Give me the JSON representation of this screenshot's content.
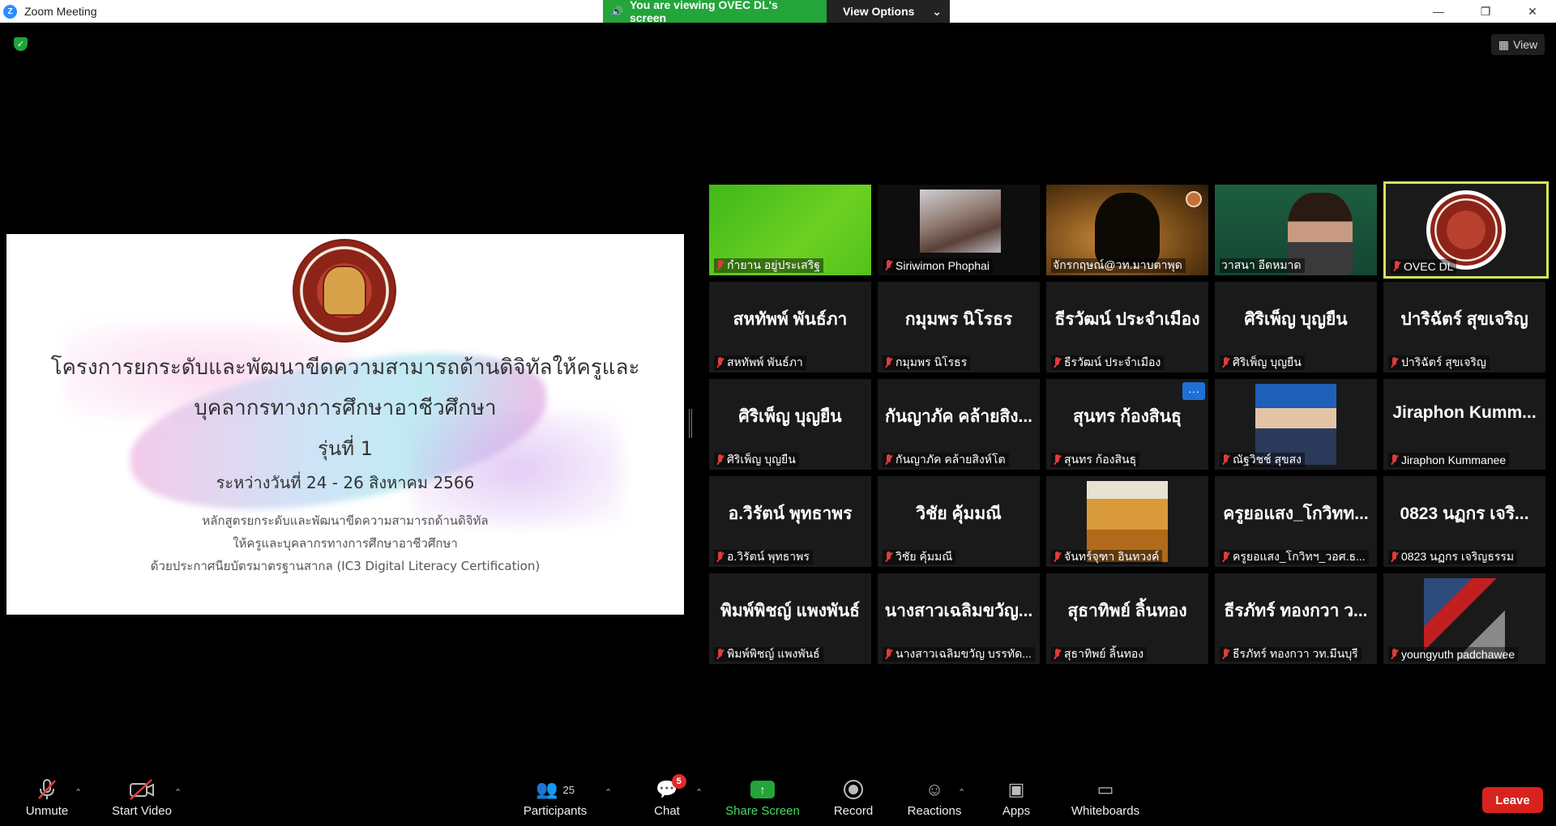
{
  "titlebar": {
    "title": "Zoom Meeting",
    "logo_glyph": "Z"
  },
  "banner": {
    "viewing_text": "You are viewing OVEC DL's screen",
    "view_options": "View Options"
  },
  "view_button": {
    "label": "View"
  },
  "slide": {
    "title_line1": "โครงการยกระดับและพัฒนาขีดความสามารถด้านดิจิทัลให้ครูและ",
    "title_line2": "บุคลากรทางการศึกษาอาชีวศึกษา",
    "generation": "รุ่นที่ 1",
    "date": "ระหว่างวันที่ 24 - 26 สิงหาคม 2566",
    "note_line1": "หลักสูตรยกระดับและพัฒนาขีดความสามารถด้านดิจิทัล",
    "note_line2": "ให้ครูและบุคลากรทางการศึกษาอาชีวศึกษา",
    "note_line3": "ด้วยประกาศนียบัตรมาตรฐานสากล (IC3 Digital Literacy Certification)"
  },
  "gallery": {
    "tiles": [
      {
        "label": "กำยาน อยู่ประเสริฐ",
        "big": ""
      },
      {
        "label": "Siriwimon Phophai",
        "big": ""
      },
      {
        "label": "จักรกฤษณ์@วท.มาบตาพุด",
        "big": ""
      },
      {
        "label": "วาสนา อีดหมาด",
        "big": ""
      },
      {
        "label": "OVEC DL",
        "big": ""
      },
      {
        "label": "สหทัพพ์ พันธ์ภา",
        "big": "สหทัพพ์ พันธ์ภา"
      },
      {
        "label": "กมุมพร นิโรธร",
        "big": "กมุมพร นิโรธร"
      },
      {
        "label": "ธีรวัฒน์ ประจำเมือง",
        "big": "ธีรวัฒน์ ประจำเมือง"
      },
      {
        "label": "ศิริเพ็ญ บุญยืน",
        "big": "ศิริเพ็ญ บุญยืน"
      },
      {
        "label": "ปาริฉัตร์ สุขเจริญ",
        "big": "ปาริฉัตร์ สุขเจริญ"
      },
      {
        "label": "ศิริเพ็ญ บุญยืน",
        "big": "ศิริเพ็ญ บุญยืน"
      },
      {
        "label": "กันญาภัค คล้ายสิงห์โต",
        "big": "กันญาภัค คล้ายสิง..."
      },
      {
        "label": "สุนทร ก้องสินธุ",
        "big": "สุนทร ก้องสินธุ"
      },
      {
        "label": "ณัฐวิชช์ สุขสง",
        "big": ""
      },
      {
        "label": "Jiraphon Kummanee",
        "big": "Jiraphon  Kumm..."
      },
      {
        "label": "อ.วิรัตน์ พุทธาพร",
        "big": "อ.วิรัตน์ พุทธาพร"
      },
      {
        "label": "วิชัย คุ้มมณี",
        "big": "วิชัย คุ้มมณี"
      },
      {
        "label": "จันทร์จุฑา อินทวงค์",
        "big": ""
      },
      {
        "label": "ครูยอแสง_โกวิทฯ_วอศ.ธ...",
        "big": "ครูยอแสง_โกวิทท..."
      },
      {
        "label": "0823 นฏกร เจริญธรรม",
        "big": "0823 นฏกร เจริ..."
      },
      {
        "label": "พิมพ์พิชญ์ แพงพันธ์",
        "big": "พิมพ์พิชญ์ แพงพันธ์"
      },
      {
        "label": "นางสาวเฉลิมขวัญ บรรทัด...",
        "big": "นางสาวเฉลิมขวัญ..."
      },
      {
        "label": "สุธาทิพย์ ลิ้นทอง",
        "big": "สุธาทิพย์ ลิ้นทอง"
      },
      {
        "label": "ธีรภัทร์ ทองกวา วท.มีนบุรี",
        "big": "ธีรภัทร์ ทองกวา ว..."
      },
      {
        "label": "youngyuth padchawee",
        "big": ""
      }
    ]
  },
  "toolbar": {
    "unmute": "Unmute",
    "start_video": "Start Video",
    "participants": "Participants",
    "participants_count": "25",
    "chat": "Chat",
    "chat_badge": "5",
    "share_screen": "Share Screen",
    "record": "Record",
    "reactions": "Reactions",
    "apps": "Apps",
    "whiteboards": "Whiteboards",
    "leave": "Leave"
  }
}
